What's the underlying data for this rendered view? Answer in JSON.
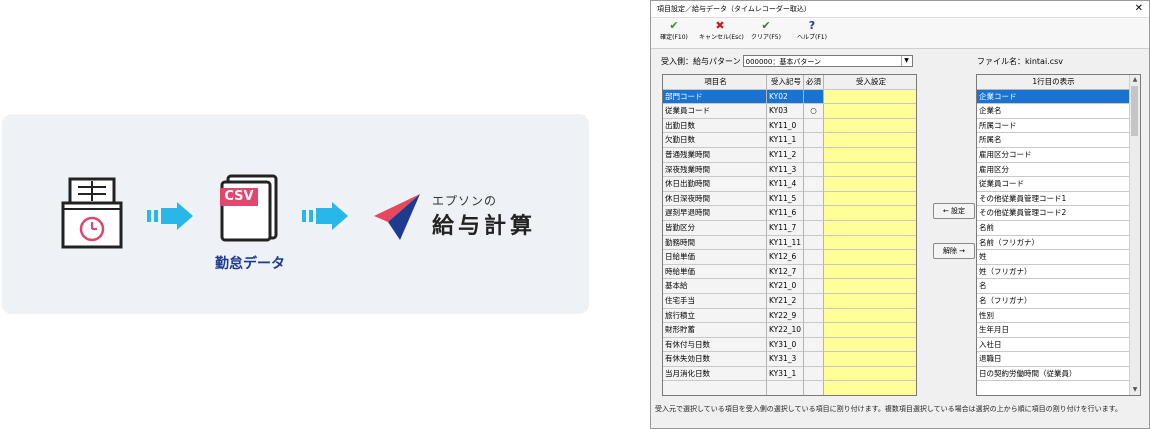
{
  "flow": {
    "csv_label": "CSV",
    "csv_caption": "勤怠データ",
    "brand_small": "エプソンの",
    "brand_big": "給与計算",
    "colors": {
      "panel_bg": "#eef1f5",
      "arrow": "#29b6e8",
      "icon_line": "#222222",
      "clock": "#e2466c",
      "csv_badge": "#e2466c",
      "caption": "#1d3b8f",
      "logo_red": "#e8485d",
      "logo_navy": "#1d3b8f"
    }
  },
  "dialog": {
    "title": "項目設定／給与データ（タイムレコーダー取込）",
    "toolbar": [
      {
        "icon": "checkmark-icon",
        "glyph": "✔",
        "label": "確定(F10)"
      },
      {
        "icon": "cancel-icon",
        "glyph": "✖",
        "label": "キャンセル(Esc)"
      },
      {
        "icon": "clear-icon",
        "glyph": "✔",
        "label": "クリア(F5)"
      },
      {
        "icon": "help-icon",
        "glyph": "?",
        "label": "ヘルプ(F1)"
      }
    ],
    "pattern_label": "受入側：給与パターン",
    "pattern_value": "000000：基本パターン",
    "file_label": "ファイル名：kintai.csv",
    "grid_headers": [
      "項目名",
      "受入記号",
      "必須",
      "受入設定"
    ],
    "grid_rows": [
      [
        "部門コード",
        "KY02",
        "",
        ""
      ],
      [
        "従業員コード",
        "KY03",
        "○",
        ""
      ],
      [
        "出勤日数",
        "KY11_0",
        "",
        ""
      ],
      [
        "欠勤日数",
        "KY11_1",
        "",
        ""
      ],
      [
        "普通残業時間",
        "KY11_2",
        "",
        ""
      ],
      [
        "深夜残業時間",
        "KY11_3",
        "",
        ""
      ],
      [
        "休日出勤時間",
        "KY11_4",
        "",
        ""
      ],
      [
        "休日深夜時間",
        "KY11_5",
        "",
        ""
      ],
      [
        "遅刻早退時間",
        "KY11_6",
        "",
        ""
      ],
      [
        "皆勤区分",
        "KY11_7",
        "",
        ""
      ],
      [
        "勤務時間",
        "KY11_11",
        "",
        ""
      ],
      [
        "日給単価",
        "KY12_6",
        "",
        ""
      ],
      [
        "時給単価",
        "KY12_7",
        "",
        ""
      ],
      [
        "基本給",
        "KY21_0",
        "",
        ""
      ],
      [
        "住宅手当",
        "KY21_2",
        "",
        ""
      ],
      [
        "旅行積立",
        "KY22_9",
        "",
        ""
      ],
      [
        "財形貯蓄",
        "KY22_10",
        "",
        ""
      ],
      [
        "有休付与日数",
        "KY31_0",
        "",
        ""
      ],
      [
        "有休失効日数",
        "KY31_3",
        "",
        ""
      ],
      [
        "当月消化日数",
        "KY31_1",
        "",
        ""
      ],
      [
        "",
        "",
        "",
        ""
      ]
    ],
    "set_button": "← 設定",
    "clear_button": "解除 →",
    "list_header": "1行目の表示",
    "list_items": [
      "企業コード",
      "企業名",
      "所属コード",
      "所属名",
      "雇用区分コード",
      "雇用区分",
      "従業員コード",
      "その他従業員管理コード1",
      "その他従業員管理コード2",
      "名前",
      "名前（フリガナ）",
      "姓",
      "姓（フリガナ）",
      "名",
      "名（フリガナ）",
      "性別",
      "生年月日",
      "入社日",
      "退職日",
      "日の契約労働時間（従業員）",
      ""
    ],
    "status_text": "受入元で選択している項目を受入側の選択している項目に割り付けます。複数項目選択している場合は選択の上から順に項目の割り付けを行います。"
  }
}
